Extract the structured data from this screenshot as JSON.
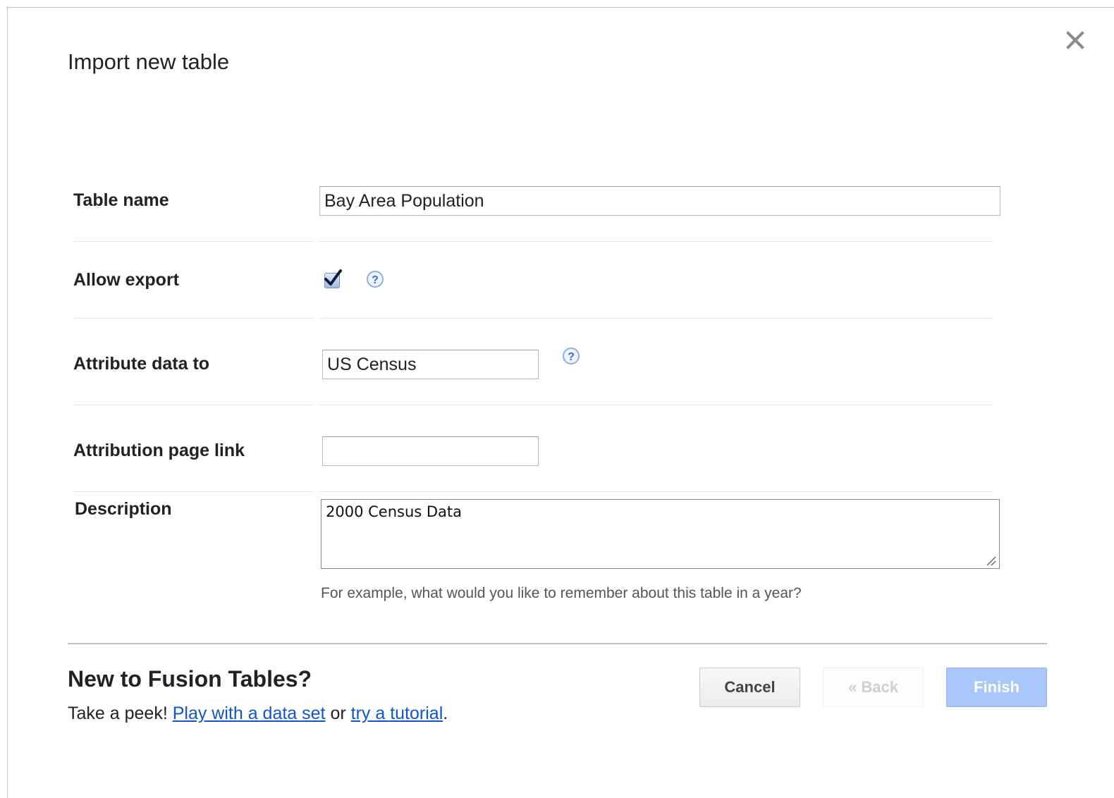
{
  "dialog": {
    "title": "Import new table",
    "close_icon": "close-icon"
  },
  "form": {
    "table_name": {
      "label": "Table name",
      "value": "Bay Area Population"
    },
    "allow_export": {
      "label": "Allow export",
      "checked": true,
      "help_icon": "help-question-icon"
    },
    "attribute_data_to": {
      "label": "Attribute data to",
      "value": "US Census",
      "help_icon": "help-question-icon"
    },
    "attribution_page_link": {
      "label": "Attribution page link",
      "value": ""
    },
    "description": {
      "label": "Description",
      "value": "2000 Census Data",
      "hint": "For example, what would you like to remember about this table in a year?"
    }
  },
  "promo": {
    "title": "New to Fusion Tables?",
    "prefix": "Take a peek! ",
    "link1": "Play with a data set",
    "middle": " or ",
    "link2": "try a tutorial",
    "suffix": "."
  },
  "buttons": {
    "cancel": "Cancel",
    "back": "« Back",
    "finish": "Finish"
  },
  "colors": {
    "link": "#1155cc",
    "finish_button": "#a9c7fa",
    "help_icon": "#6b9bd8"
  }
}
